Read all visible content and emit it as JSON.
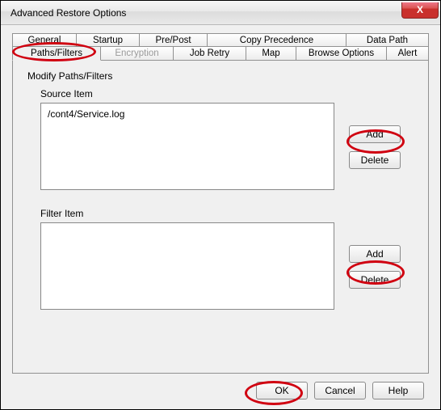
{
  "window": {
    "title": "Advanced Restore Options",
    "close_symbol": "X"
  },
  "tabs": {
    "row1": {
      "general": "General",
      "startup": "Startup",
      "prepost": "Pre/Post",
      "copy_precedence": "Copy Precedence",
      "data_path": "Data Path"
    },
    "row2": {
      "paths_filters": "Paths/Filters",
      "encryption": "Encryption",
      "job_retry": "Job Retry",
      "map": "Map",
      "browse_options": "Browse Options",
      "alert": "Alert"
    }
  },
  "panel": {
    "heading": "Modify Paths/Filters",
    "source": {
      "label": "Source Item",
      "items": [
        "/cont4/Service.log"
      ],
      "add": "Add",
      "delete": "Delete"
    },
    "filter": {
      "label": "Filter Item",
      "items": [],
      "add": "Add",
      "delete": "Delete"
    }
  },
  "footer": {
    "ok": "OK",
    "cancel": "Cancel",
    "help": "Help"
  }
}
